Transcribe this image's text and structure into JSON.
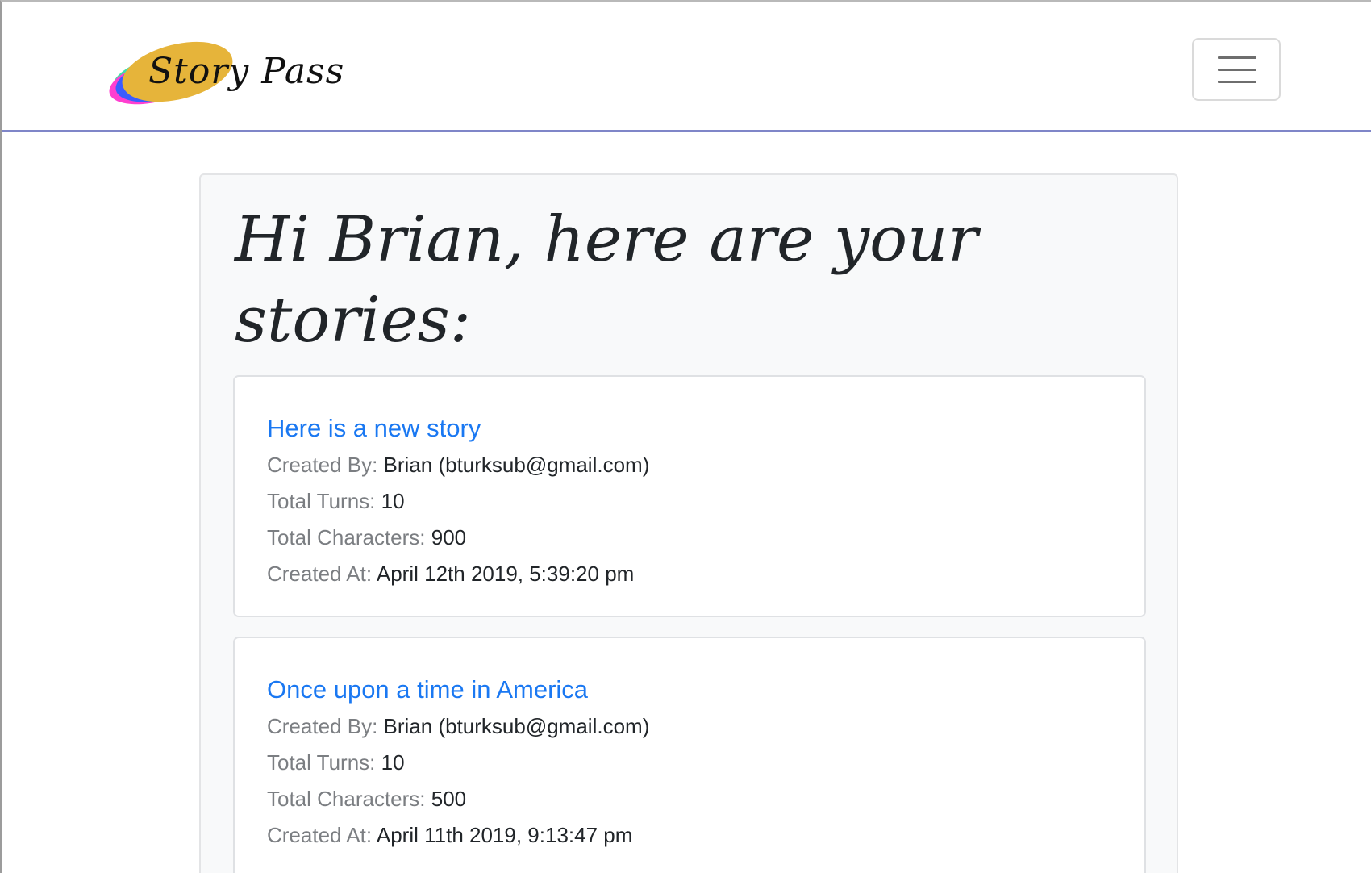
{
  "brand": {
    "logo_text": "Story Pass"
  },
  "header": {
    "menu_toggle_icon": "hamburger-menu-icon"
  },
  "colors": {
    "link": "#1a78f2",
    "label": "#7b7e82",
    "text": "#212529",
    "container_bg": "#f8f9fa",
    "navbar_border": "#7f86c8"
  },
  "main": {
    "title": "Hi Brian, here are your stories:",
    "stories": [
      {
        "title": "Here is a new story",
        "created_by_label": "Created By:",
        "created_by": "Brian (bturksub@gmail.com)",
        "total_turns_label": "Total Turns:",
        "total_turns": "10",
        "total_characters_label": "Total Characters:",
        "total_characters": "900",
        "created_at_label": "Created At:",
        "created_at": "April 12th 2019, 5:39:20 pm"
      },
      {
        "title": "Once upon a time in America",
        "created_by_label": "Created By:",
        "created_by": "Brian (bturksub@gmail.com)",
        "total_turns_label": "Total Turns:",
        "total_turns": "10",
        "total_characters_label": "Total Characters:",
        "total_characters": "500",
        "created_at_label": "Created At:",
        "created_at": "April 11th 2019, 9:13:47 pm"
      }
    ]
  }
}
